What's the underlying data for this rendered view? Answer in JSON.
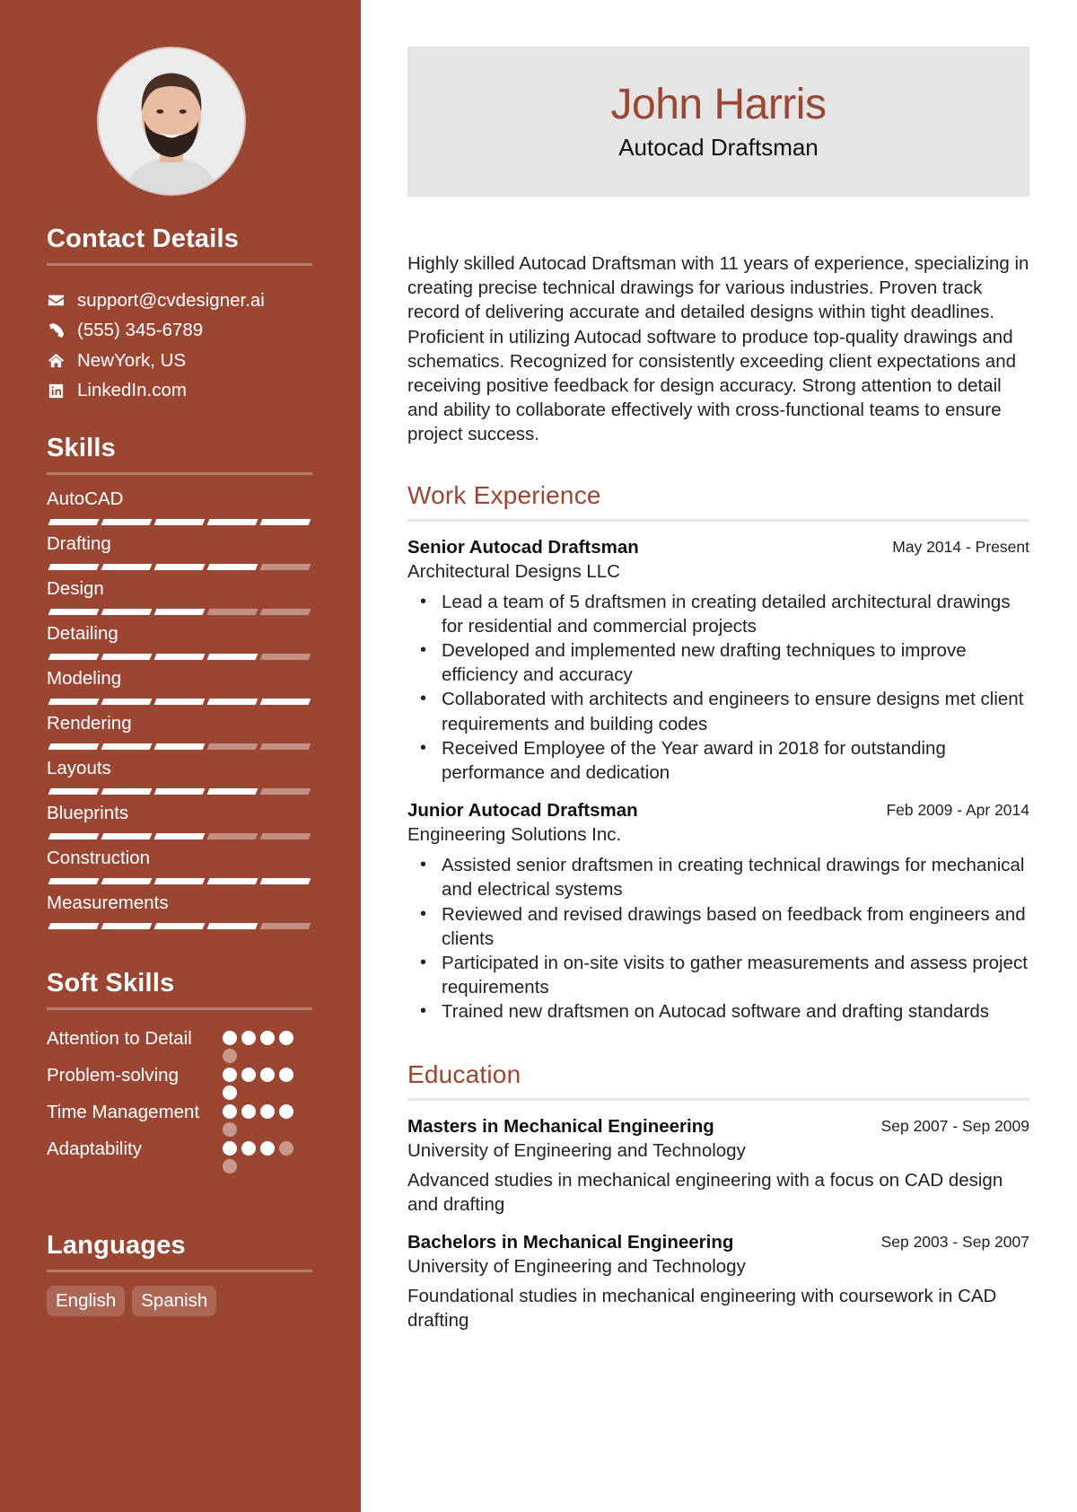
{
  "profile": {
    "name": "John Harris",
    "title": "Autocad Draftsman",
    "photo_icon": "profile-photo"
  },
  "colors": {
    "accent": "#9a4632",
    "header_bg": "#e5e5e5"
  },
  "contact": {
    "heading": "Contact Details",
    "items": [
      {
        "icon": "envelope-icon",
        "label": "support@cvdesigner.ai"
      },
      {
        "icon": "phone-icon",
        "label": "(555) 345-6789"
      },
      {
        "icon": "home-icon",
        "label": "NewYork, US"
      },
      {
        "icon": "linkedin-icon",
        "label": "LinkedIn.com"
      }
    ]
  },
  "skills": {
    "heading": "Skills",
    "max": 5,
    "items": [
      {
        "name": "AutoCAD",
        "level": 5
      },
      {
        "name": "Drafting",
        "level": 4
      },
      {
        "name": "Design",
        "level": 3
      },
      {
        "name": "Detailing",
        "level": 4
      },
      {
        "name": "Modeling",
        "level": 5
      },
      {
        "name": "Rendering",
        "level": 3
      },
      {
        "name": "Layouts",
        "level": 4
      },
      {
        "name": "Blueprints",
        "level": 3
      },
      {
        "name": "Construction",
        "level": 5
      },
      {
        "name": "Measurements",
        "level": 4
      }
    ]
  },
  "soft_skills": {
    "heading": "Soft Skills",
    "max": 5,
    "items": [
      {
        "name": "Attention to Detail",
        "level": 4
      },
      {
        "name": "Problem-solving",
        "level": 5
      },
      {
        "name": "Time Management",
        "level": 4
      },
      {
        "name": "Adaptability",
        "level": 3
      }
    ]
  },
  "languages": {
    "heading": "Languages",
    "items": [
      "English",
      "Spanish"
    ]
  },
  "summary": "Highly skilled Autocad Draftsman with 11 years of experience, specializing in creating precise technical drawings for various industries. Proven track record of delivering accurate and detailed designs within tight deadlines. Proficient in utilizing Autocad software to produce top-quality drawings and schematics. Recognized for consistently exceeding client expectations and receiving positive feedback for design accuracy. Strong attention to detail and ability to collaborate effectively with cross-functional teams to ensure project success.",
  "work": {
    "heading": "Work Experience",
    "jobs": [
      {
        "title": "Senior Autocad Draftsman",
        "company": "Architectural Designs LLC",
        "dates": "May 2014 - Present",
        "bullets": [
          "Lead a team of 5 draftsmen in creating detailed architectural drawings for residential and commercial projects",
          "Developed and implemented new drafting techniques to improve efficiency and accuracy",
          "Collaborated with architects and engineers to ensure designs met client requirements and building codes",
          "Received Employee of the Year award in 2018 for outstanding performance and dedication"
        ]
      },
      {
        "title": "Junior Autocad Draftsman",
        "company": "Engineering Solutions Inc.",
        "dates": "Feb 2009 - Apr 2014",
        "bullets": [
          "Assisted senior draftsmen in creating technical drawings for mechanical and electrical systems",
          "Reviewed and revised drawings based on feedback from engineers and clients",
          "Participated in on-site visits to gather measurements and assess project requirements",
          "Trained new draftsmen on Autocad software and drafting standards"
        ]
      }
    ]
  },
  "education": {
    "heading": "Education",
    "items": [
      {
        "degree": "Masters in Mechanical Engineering",
        "school": "University of Engineering and Technology",
        "dates": "Sep 2007 - Sep 2009",
        "description": "Advanced studies in mechanical engineering with a focus on CAD design and drafting"
      },
      {
        "degree": "Bachelors in Mechanical Engineering",
        "school": "University of Engineering and Technology",
        "dates": "Sep 2003 - Sep 2007",
        "description": "Foundational studies in mechanical engineering with coursework in CAD drafting"
      }
    ]
  }
}
